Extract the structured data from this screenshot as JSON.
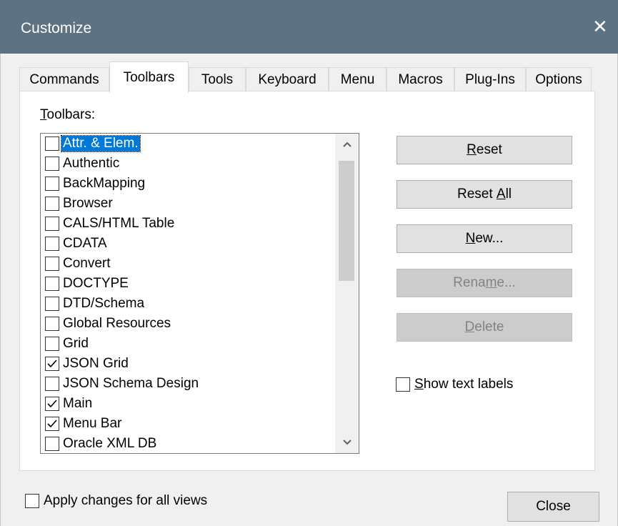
{
  "window": {
    "title": "Customize",
    "close_glyph": "✕"
  },
  "tabs": [
    {
      "label": "Commands"
    },
    {
      "label": "Toolbars"
    },
    {
      "label": "Tools"
    },
    {
      "label": "Keyboard"
    },
    {
      "label": "Menu"
    },
    {
      "label": "Macros"
    },
    {
      "label": "Plug-Ins"
    },
    {
      "label": "Options"
    }
  ],
  "active_tab": "Toolbars",
  "toolbars_label": {
    "mnemonic": "T",
    "rest": "oolbars:"
  },
  "toolbars": [
    {
      "label": "Attr. & Elem.",
      "checked": false,
      "selected": true
    },
    {
      "label": "Authentic",
      "checked": false
    },
    {
      "label": "BackMapping",
      "checked": false
    },
    {
      "label": "Browser",
      "checked": false
    },
    {
      "label": "CALS/HTML Table",
      "checked": false
    },
    {
      "label": "CDATA",
      "checked": false
    },
    {
      "label": "Convert",
      "checked": false
    },
    {
      "label": "DOCTYPE",
      "checked": false
    },
    {
      "label": "DTD/Schema",
      "checked": false
    },
    {
      "label": "Global Resources",
      "checked": false
    },
    {
      "label": "Grid",
      "checked": false
    },
    {
      "label": "JSON Grid",
      "checked": true
    },
    {
      "label": "JSON Schema Design",
      "checked": false
    },
    {
      "label": "Main",
      "checked": true
    },
    {
      "label": "Menu Bar",
      "checked": true
    },
    {
      "label": "Oracle XML DB",
      "checked": false
    }
  ],
  "buttons": {
    "reset": {
      "mnemonic": "R",
      "rest": "eset"
    },
    "reset_all": {
      "before": "Reset ",
      "mnemonic": "A",
      "rest": "ll"
    },
    "new": {
      "mnemonic": "N",
      "rest": "ew..."
    },
    "rename": {
      "before": "Rena",
      "mnemonic": "m",
      "rest": "e..."
    },
    "delete": {
      "mnemonic": "D",
      "rest": "elete"
    },
    "close": "Close"
  },
  "show_text_labels": {
    "mnemonic": "S",
    "rest": "how text labels",
    "checked": false
  },
  "apply_all_views": {
    "label": "Apply changes for all views",
    "checked": false
  },
  "icons": {
    "up": "chevron-up-icon",
    "down": "chevron-down-icon",
    "check": "checkmark-icon"
  }
}
